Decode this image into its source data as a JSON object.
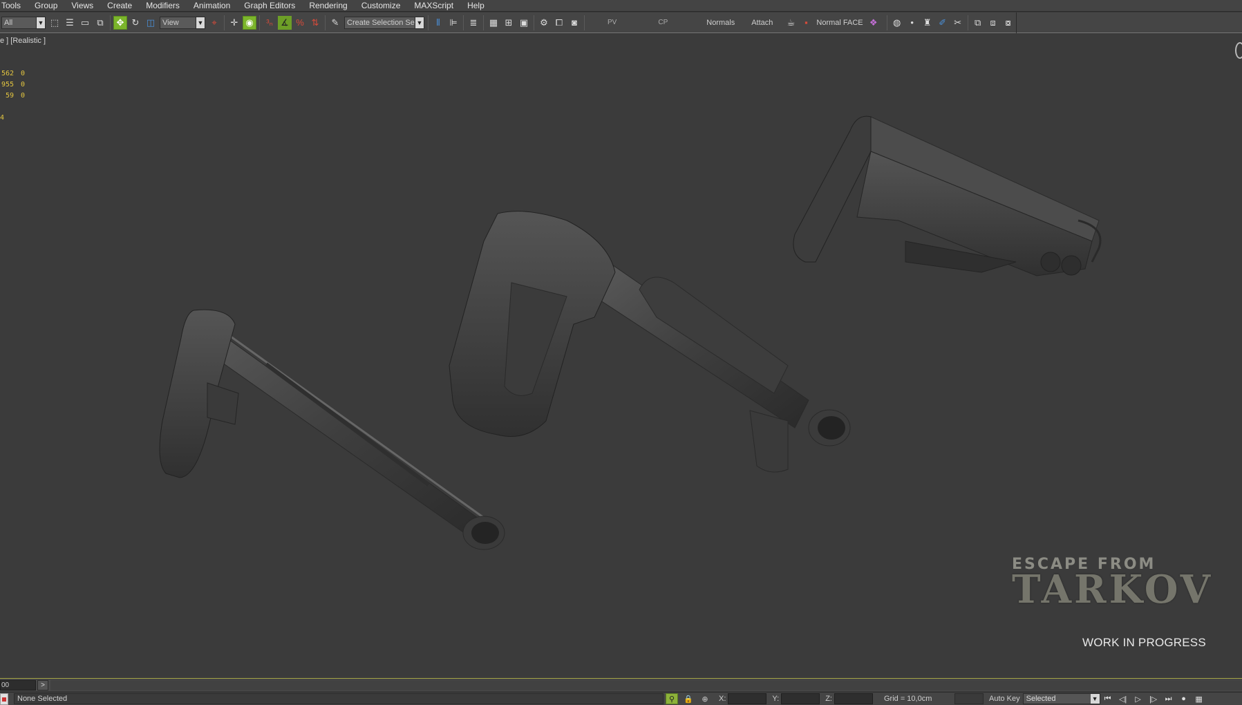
{
  "menu": [
    "Tools",
    "Group",
    "Views",
    "Create",
    "Modifiers",
    "Animation",
    "Graph Editors",
    "Rendering",
    "Customize",
    "MAXScript",
    "Help"
  ],
  "toolbar": {
    "filter_value": "All",
    "refcoord_value": "View",
    "named_selection_value": "Create Selection Se",
    "pv_label": "PV",
    "cp_label": "CP",
    "normals_label": "Normals",
    "attach_label": "Attach",
    "normal_face_label": "Normal FACE"
  },
  "viewport": {
    "label": "e ] [Realistic ]",
    "stats": [
      {
        "a": "562",
        "b": "0"
      },
      {
        "a": "955",
        "b": "0"
      },
      {
        "a": "59",
        "b": "0"
      }
    ],
    "stats_extra": "4"
  },
  "watermark": {
    "line1": "ESCAPE FROM",
    "line2": "TARKOV",
    "wip": "WORK IN PROGRESS"
  },
  "timeline": {
    "frame_value": "00",
    "next_label": ">"
  },
  "status": {
    "selection_text": "None Selected",
    "x_label": "X:",
    "y_label": "Y:",
    "z_label": "Z:",
    "grid_text": "Grid = 10,0cm",
    "autokey_label": "Auto Key",
    "selected_value": "Selected"
  },
  "colors": {
    "viewport_bg": "#3b3b3b",
    "stats_yellow": "#e4c640",
    "active_green": "#7bb52b",
    "model_gray": "#4a4a4a"
  }
}
